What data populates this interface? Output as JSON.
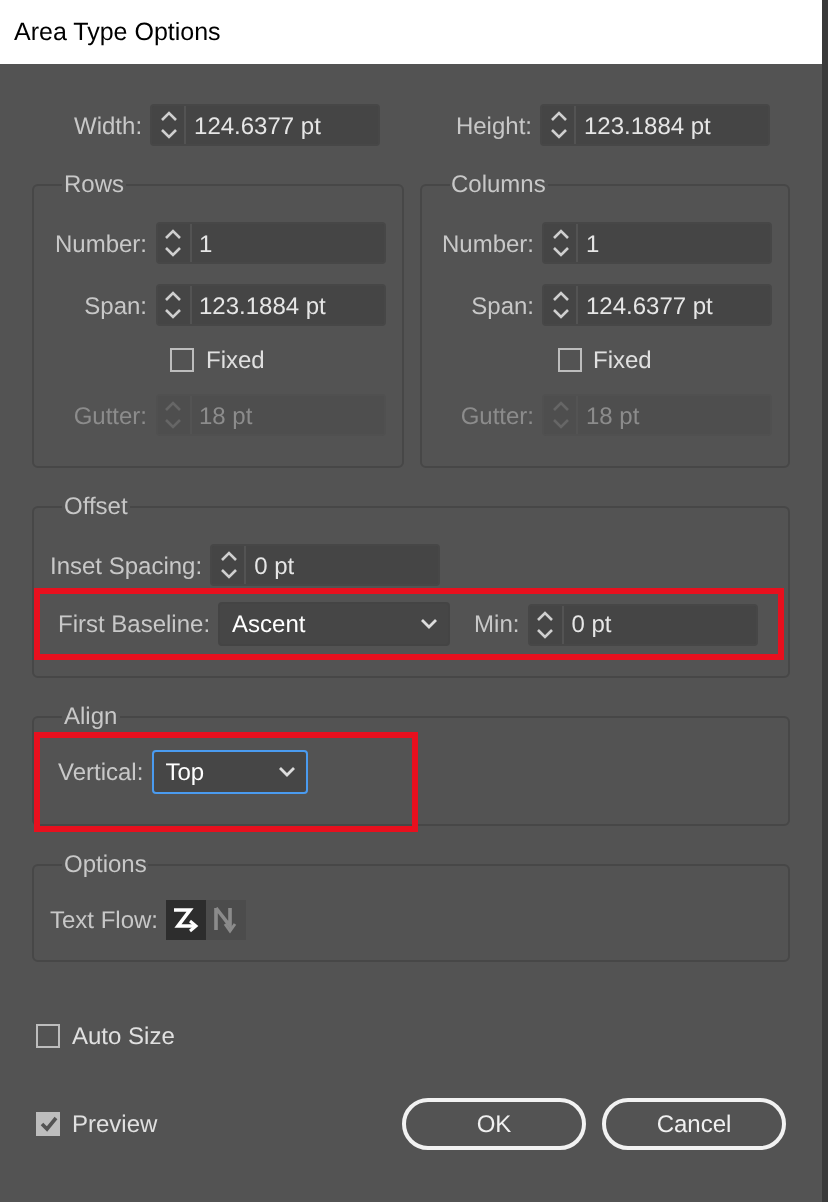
{
  "window": {
    "title": "Area Type Options"
  },
  "size": [
    {
      "label": "Width:",
      "value": "124.6377 pt"
    },
    {
      "label": "Height:",
      "value": "123.1884 pt"
    }
  ],
  "groups": [
    {
      "title": "Rows",
      "fields": [
        {
          "label": "Number:",
          "value": "1"
        },
        {
          "label": "Span:",
          "value": "123.1884 pt"
        }
      ],
      "fixed": {
        "label": "Fixed",
        "checked": false
      },
      "gutter": {
        "label": "Gutter:",
        "value": "18 pt",
        "disabled": true
      }
    },
    {
      "title": "Columns",
      "fields": [
        {
          "label": "Number:",
          "value": "1"
        },
        {
          "label": "Span:",
          "value": "124.6377 pt"
        }
      ],
      "fixed": {
        "label": "Fixed",
        "checked": false
      },
      "gutter": {
        "label": "Gutter:",
        "value": "18 pt",
        "disabled": true
      }
    }
  ],
  "offset": {
    "title": "Offset",
    "inset": {
      "label": "Inset Spacing:",
      "value": "0 pt"
    },
    "first_baseline": {
      "label": "First Baseline:",
      "value": "Ascent",
      "min_label": "Min:",
      "min_value": "0 pt",
      "highlighted": true
    }
  },
  "align": {
    "title": "Align",
    "vertical": {
      "label": "Vertical:",
      "value": "Top",
      "focused": true,
      "highlighted": true
    }
  },
  "options": {
    "title": "Options",
    "text_flow": {
      "label": "Text Flow:",
      "buttons": [
        {
          "selected": true
        },
        {
          "selected": false
        }
      ]
    }
  },
  "checkboxes": [
    {
      "label": "Auto Size",
      "checked": false
    },
    {
      "label": "Preview",
      "checked": true
    }
  ],
  "buttons": [
    "OK",
    "Cancel"
  ]
}
